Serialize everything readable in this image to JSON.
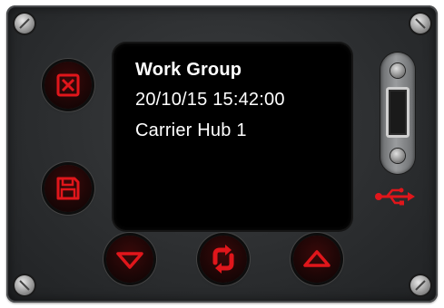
{
  "display": {
    "line1": "Work Group",
    "line2": "20/10/15 15:42:00",
    "line3": "Carrier Hub 1"
  },
  "buttons": {
    "cancel": "close-icon",
    "save": "floppy-disk-icon",
    "down": "triangle-down-icon",
    "refresh": "refresh-icon",
    "up": "triangle-up-icon"
  },
  "colors": {
    "panel": "#2c2e30",
    "screen": "#000000",
    "screen_text": "#ffffff",
    "accent_red": "#e0161b"
  },
  "icons": {
    "usb": "usb-icon"
  }
}
